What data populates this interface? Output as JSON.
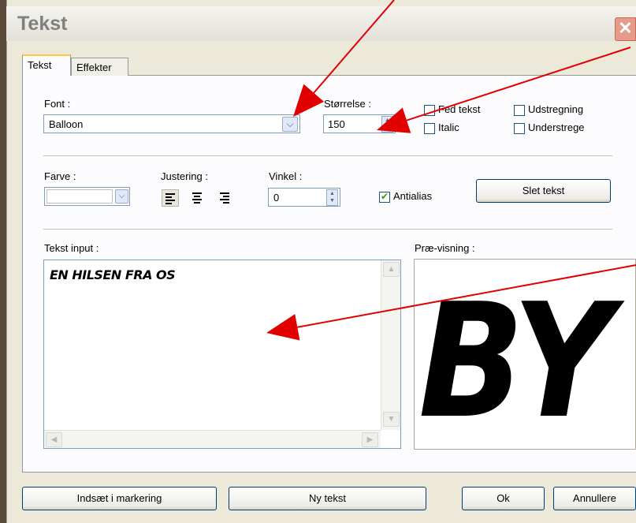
{
  "window": {
    "title": "Tekst",
    "close_glyph": "✕"
  },
  "tabs": [
    {
      "label": "Tekst"
    },
    {
      "label": "Effekter"
    }
  ],
  "font": {
    "label": "Font :",
    "value": "Balloon"
  },
  "size": {
    "label": "Størrelse :",
    "value": "150"
  },
  "styles": {
    "bold": {
      "label": "Fed tekst",
      "checked": false
    },
    "italic": {
      "label": "Italic",
      "checked": false
    },
    "strikethrough": {
      "label": "Udstregning",
      "checked": false
    },
    "underline": {
      "label": "Understrege",
      "checked": false
    }
  },
  "color": {
    "label": "Farve :"
  },
  "alignment": {
    "label": "Justering :",
    "selected": "left"
  },
  "angle": {
    "label": "Vinkel :",
    "value": "0"
  },
  "antialias": {
    "label": "Antialias",
    "checked": true
  },
  "delete_text_button": "Slet tekst",
  "text_input": {
    "label": "Tekst input :",
    "value": "EN HILSEN FRA OS"
  },
  "preview": {
    "label": "Præ-visning :",
    "sample": "BY"
  },
  "footer": {
    "insert_button": "Indsæt i markering",
    "new_text_button": "Ny tekst",
    "ok_button": "Ok",
    "cancel_button": "Annullere"
  },
  "annotation_color": "#e00000",
  "icons": {
    "dropdown": "chevron-down-icon",
    "spin_up": "spin-up-icon",
    "spin_down": "spin-down-icon",
    "align_left": "align-left-icon",
    "align_center": "align-center-icon",
    "align_right": "align-right-icon",
    "close": "close-icon"
  }
}
